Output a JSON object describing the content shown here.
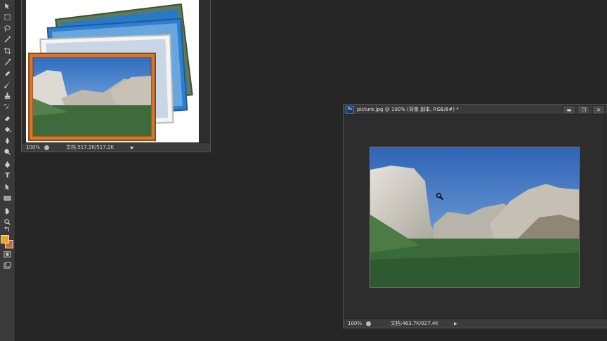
{
  "toolbar": {
    "tools": [
      "move-icon",
      "marquee-icon",
      "lasso-icon",
      "magic-wand-icon",
      "crop-icon",
      "eyedropper-icon",
      "spot-heal-icon",
      "brush-icon",
      "clone-stamp-icon",
      "history-brush-icon",
      "eraser-icon",
      "paint-bucket-icon",
      "blur-icon",
      "dodge-icon",
      "pen-icon",
      "type-icon",
      "path-select-icon",
      "rectangle-icon",
      "hand-icon",
      "zoom-icon"
    ],
    "type_glyph": "T",
    "foreground_color": "#f2a51c",
    "background_color": "#c96a3a"
  },
  "doc1": {
    "zoom": "100%",
    "info": "文档:517.2K/517.2K",
    "arrow": "▶"
  },
  "doc2": {
    "title": "picture.jpg @ 100% (背景 副本, RGB/8#) *",
    "ps_badge": "Ps",
    "zoom": "100%",
    "info": "文档:463.7K/927.4K",
    "arrow": "▶",
    "buttons": {
      "minimize": "▬",
      "maximize": "❐",
      "close": "✕"
    }
  },
  "colors": {
    "workspace": "#262626",
    "panel": "#3a3a3a",
    "frame_orange": "#d4772e",
    "frame_blue": "#2a79c9",
    "frame_green": "#5e7a56",
    "sky": "#4f86c6"
  }
}
